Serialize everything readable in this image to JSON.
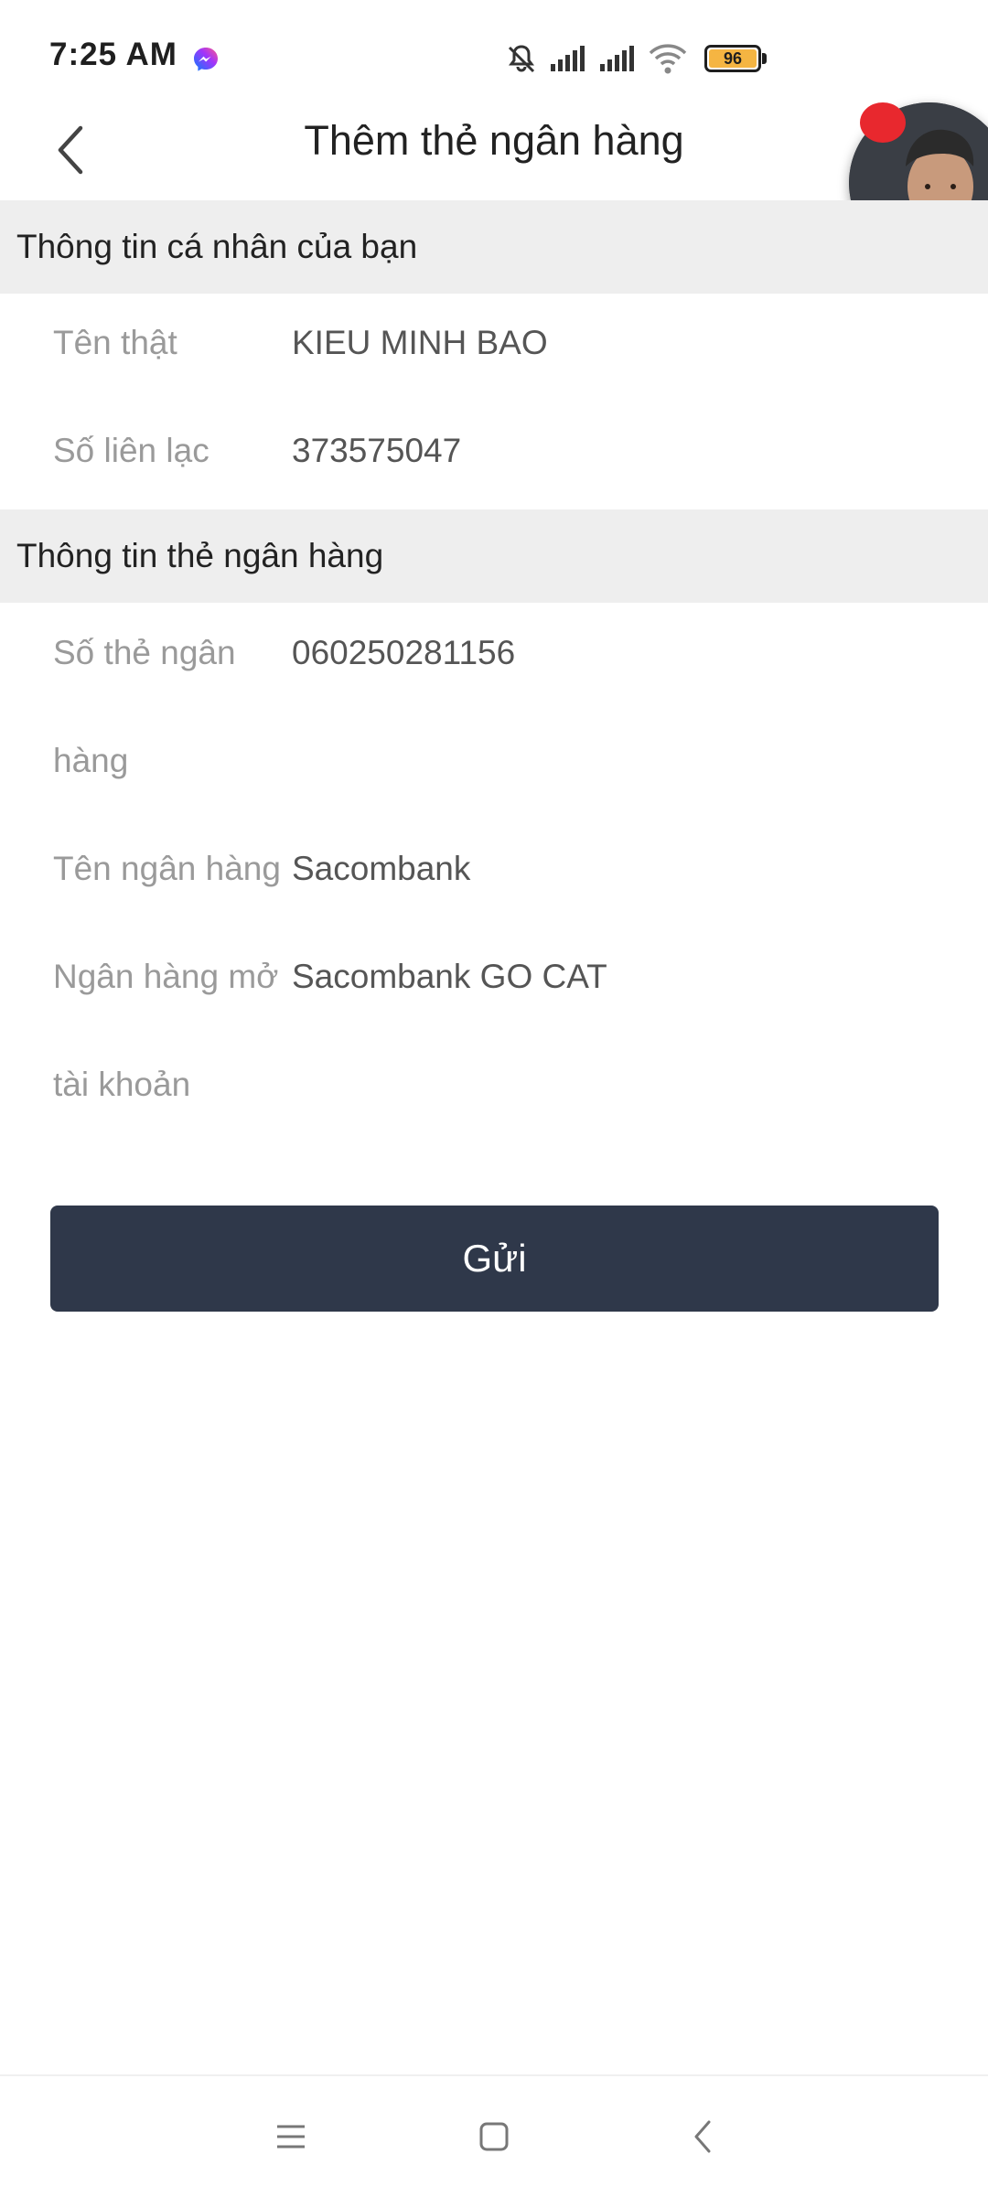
{
  "status_bar": {
    "time": "7:25 AM",
    "battery_level": "96",
    "icons": [
      "messenger-icon",
      "mute-icon",
      "signal-icon",
      "signal-icon",
      "wifi-icon",
      "battery-icon"
    ]
  },
  "header": {
    "title": "Thêm thẻ ngân hàng",
    "back_icon": "back-chevron-icon"
  },
  "personal_section": {
    "title": "Thông tin cá nhân của bạn",
    "rows": [
      {
        "label": "Tên thật",
        "value": "KIEU MINH BAO"
      },
      {
        "label": "Số liên lạc",
        "value": "373575047"
      }
    ]
  },
  "bank_section": {
    "title": "Thông tin thẻ ngân hàng",
    "rows": [
      {
        "label": "Số thẻ ngân hàng",
        "value": "060250281156"
      },
      {
        "label": "Tên ngân hàng",
        "value": "Sacombank"
      },
      {
        "label": "Ngân hàng mở tài khoản",
        "value": "Sacombank GO CAT"
      }
    ]
  },
  "submit": {
    "label": "Gửi"
  },
  "nav": {
    "icons": [
      "menu-icon",
      "home-square-icon",
      "back-icon"
    ]
  },
  "colors": {
    "button_bg": "#2f384a",
    "section_bg": "#eeeeee",
    "label_color": "#9a9a9a",
    "value_color": "#555555",
    "battery_fill": "#f5b542",
    "badge_red": "#e8282e"
  }
}
